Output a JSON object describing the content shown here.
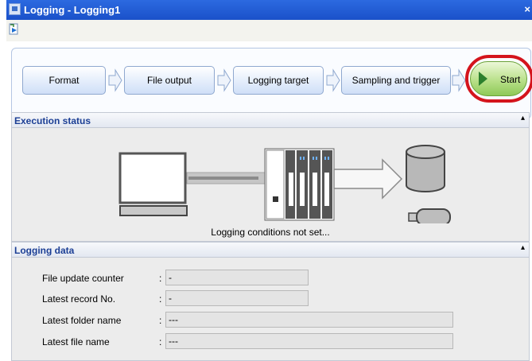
{
  "window": {
    "title": "Logging - Logging1",
    "close_glyph": "×",
    "icon": "app-icon"
  },
  "toolbar": {
    "icon": "arrow-tool-icon"
  },
  "flow": {
    "steps": [
      {
        "label": "Format"
      },
      {
        "label": "File output"
      },
      {
        "label": "Logging target"
      },
      {
        "label": "Sampling and trigger"
      }
    ],
    "start_label": "Start"
  },
  "execution_status": {
    "title": "Execution status",
    "collapse_glyph": "▴",
    "message": "Logging conditions not set..."
  },
  "logging_data": {
    "title": "Logging data",
    "collapse_glyph": "▴",
    "rows": [
      {
        "label": "File update counter",
        "colon": ":",
        "value": "-"
      },
      {
        "label": "Latest record No.",
        "colon": ":",
        "value": "-"
      },
      {
        "label": "Latest folder name",
        "colon": ":",
        "value": "---"
      },
      {
        "label": "Latest file name",
        "colon": ":",
        "value": "---"
      }
    ]
  },
  "colors": {
    "title_bar": "#1a51c9",
    "section_title": "#1c3f95",
    "start_highlight": "#d4141c",
    "start_button": "#8ec957"
  }
}
